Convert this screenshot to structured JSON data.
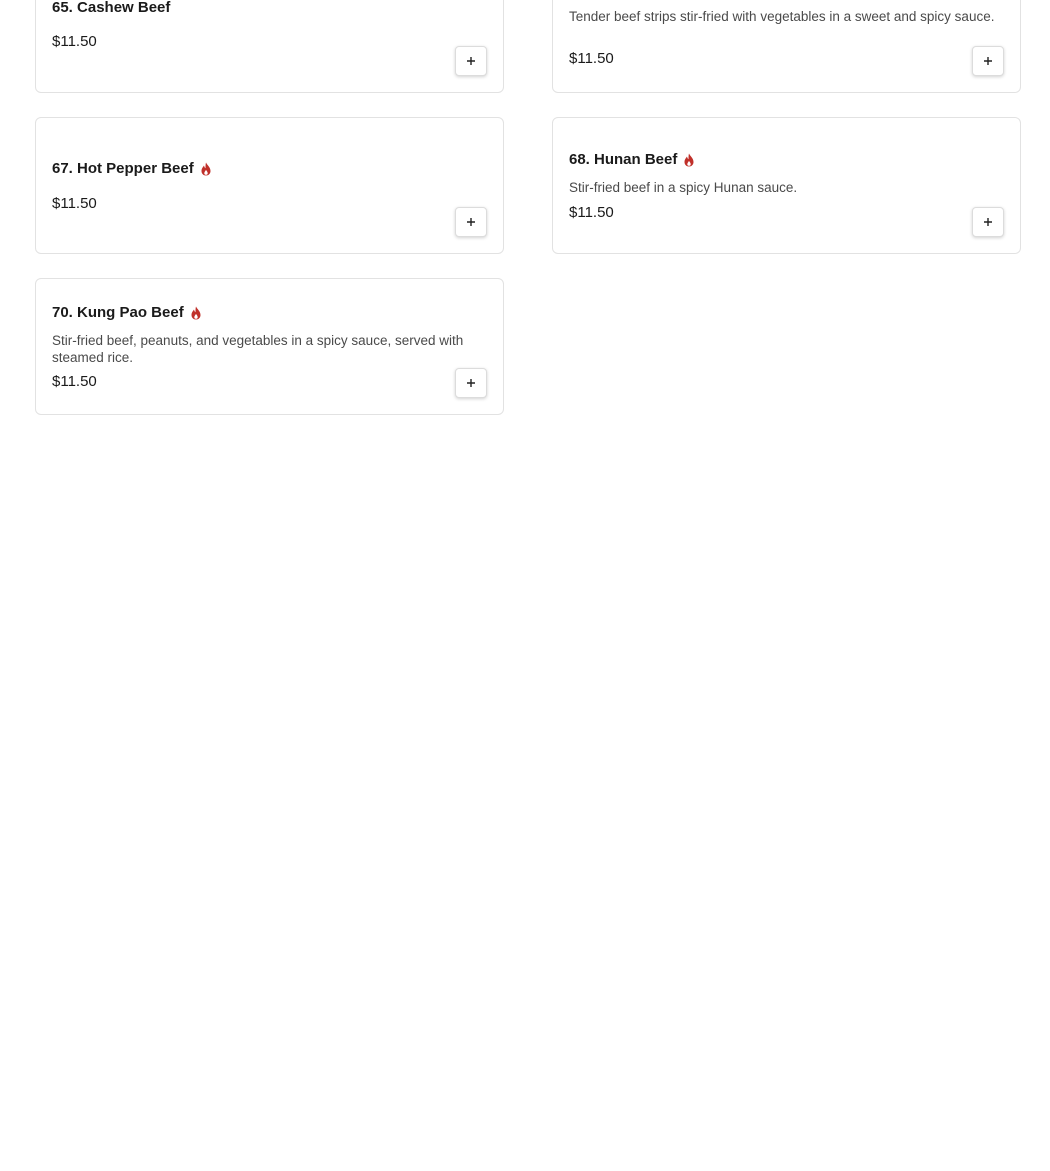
{
  "items": [
    {
      "name": "65. Cashew Beef",
      "description": "",
      "price": "$11.50",
      "spicy": false
    },
    {
      "name": "",
      "description": "Tender beef strips stir-fried with vegetables in a sweet and spicy sauce.",
      "price": "$11.50",
      "spicy": false
    },
    {
      "name": "67. Hot Pepper Beef",
      "description": "",
      "price": "$11.50",
      "spicy": true
    },
    {
      "name": "68. Hunan Beef",
      "description": "Stir-fried beef in a spicy Hunan sauce.",
      "price": "$11.50",
      "spicy": true
    },
    {
      "name": "70. Kung Pao Beef",
      "description": "Stir-fried beef, peanuts, and vegetables in a spicy sauce, served with steamed rice.",
      "price": "$11.50",
      "spicy": true
    }
  ],
  "icons": {
    "add": "plus-icon",
    "spicy": "flame-icon"
  },
  "colors": {
    "spicy": "#c0302a",
    "border": "#e2e2e2"
  }
}
